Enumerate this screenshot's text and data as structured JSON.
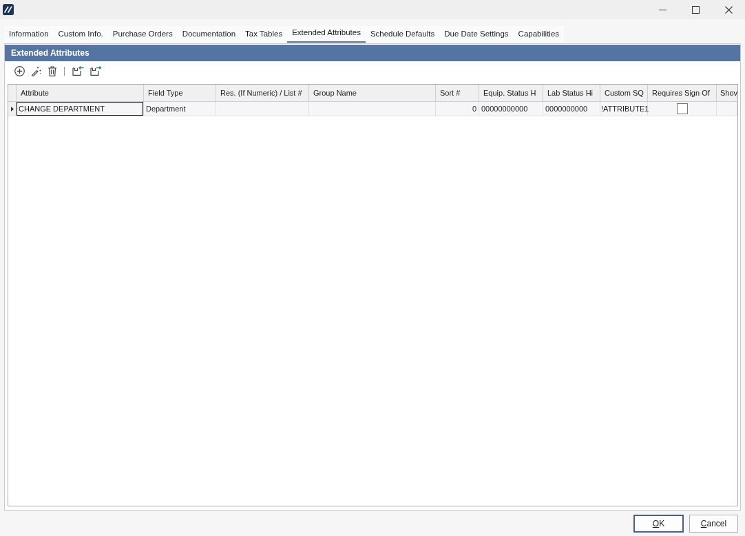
{
  "tabs": [
    {
      "label": "Information",
      "selected": false
    },
    {
      "label": "Custom Info.",
      "selected": false
    },
    {
      "label": "Purchase Orders",
      "selected": false
    },
    {
      "label": "Documentation",
      "selected": false
    },
    {
      "label": "Tax Tables",
      "selected": false
    },
    {
      "label": "Extended Attributes",
      "selected": true
    },
    {
      "label": "Schedule Defaults",
      "selected": false
    },
    {
      "label": "Due Date Settings",
      "selected": false
    },
    {
      "label": "Capabilities",
      "selected": false
    }
  ],
  "panel": {
    "title": "Extended Attributes"
  },
  "grid": {
    "columns": [
      "Attribute",
      "Field Type",
      "Res. (If Numeric) / List #",
      "Group Name",
      "Sort #",
      "Equip. Status H",
      "Lab Status Hi",
      "Custom SQ",
      "Requires Sign Of",
      "Shov"
    ],
    "rows": [
      {
        "current": true,
        "cells": [
          {
            "kind": "text",
            "text": "CHANGE DEPARTMENT",
            "focused": true
          },
          {
            "kind": "text",
            "text": "Department",
            "focused": false
          },
          {
            "kind": "empty",
            "focused": false
          },
          {
            "kind": "empty",
            "focused": false
          },
          {
            "kind": "number",
            "text": "0",
            "focused": false
          },
          {
            "kind": "text",
            "text": "00000000000",
            "focused": false
          },
          {
            "kind": "text",
            "text": "0000000000",
            "focused": false
          },
          {
            "kind": "text",
            "text": "!ATTRIBUTE1",
            "focused": false
          },
          {
            "kind": "checkbox",
            "checked": false,
            "focused": false
          },
          {
            "kind": "empty",
            "focused": false
          }
        ]
      }
    ]
  },
  "buttons": [
    {
      "label": "OK",
      "default": true,
      "mnemonic": true
    },
    {
      "label": "Cancel",
      "default": false,
      "mnemonic": true
    }
  ]
}
